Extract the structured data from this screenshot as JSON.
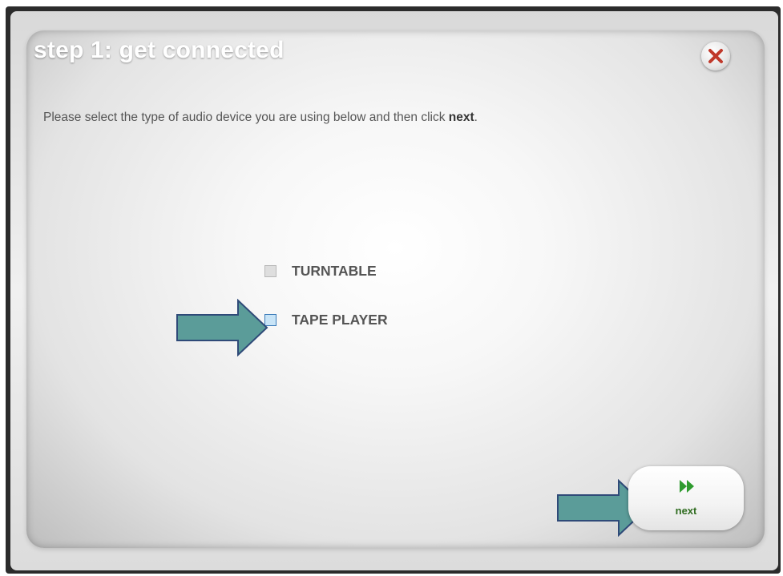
{
  "dialog": {
    "title": "step 1: get connected",
    "close_icon": "close-x-icon",
    "instructions_prefix": "Please select the type of audio device you are using below and then click ",
    "instructions_bold": "next",
    "instructions_suffix": "."
  },
  "options": [
    {
      "label": "TURNTABLE",
      "selected": false
    },
    {
      "label": "TAPE PLAYER",
      "selected": false,
      "highlighted": true
    }
  ],
  "next_button": {
    "label": "next",
    "icon": "fast-forward-icon"
  },
  "colors": {
    "title": "#ffffff",
    "close_x": "#c0392b",
    "annotation_arrow": "#5b9c99",
    "annotation_arrow_stroke": "#2f4a78",
    "next_icon": "#2e9b2e",
    "next_label": "#2e6b1e"
  }
}
